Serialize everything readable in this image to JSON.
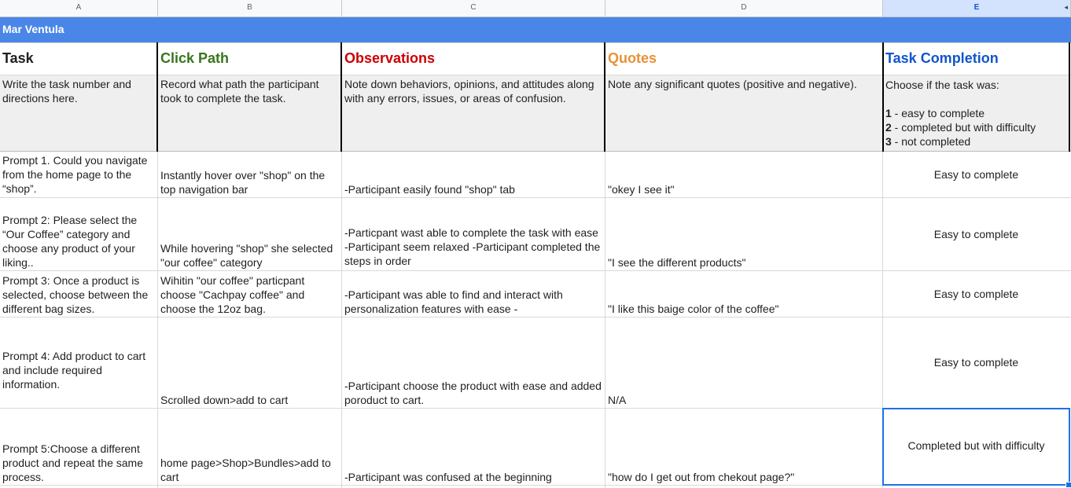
{
  "columns": [
    "A",
    "B",
    "C",
    "D",
    "E"
  ],
  "selected_column": "E",
  "title_band": "Mar Ventula",
  "headers": {
    "task": "Task",
    "click_path": "Click Path",
    "observations": "Observations",
    "quotes": "Quotes",
    "task_completion": "Task Completion"
  },
  "header_colors": {
    "task": "#000000",
    "click_path": "#38761d",
    "observations": "#cc0000",
    "quotes": "#e69138",
    "task_completion": "#1155cc"
  },
  "descriptions": {
    "task": "Write the task number and directions here.",
    "click_path": "Record what path the participant took to complete the task.",
    "observations": "Note down behaviors, opinions, and attitudes along with any errors, issues, or areas of confusion.",
    "quotes": "Note any significant quotes (positive and negative).",
    "task_completion_intro": "Choose if the task was:",
    "scale": [
      {
        "num": "1",
        "text": " - easy to complete"
      },
      {
        "num": "2",
        "text": " - completed but with difficulty"
      },
      {
        "num": "3",
        "text": " - not completed"
      }
    ]
  },
  "rows": [
    {
      "task": "Prompt 1.  Could you navigate from the home page to the “shop”.",
      "click_path": "Instantly hover over \"shop\" on the top navigation bar",
      "observations": "-Participant easily found \"shop\" tab",
      "quotes": "\"okey I see it\"",
      "completion": "Easy to complete"
    },
    {
      "task": "Prompt 2: Please select the “Our Coffee” category and choose any product of your liking..",
      "click_path": "While hovering \"shop\" she selected \"our coffee\" category",
      "observations": "-Particpant wast able to complete the task with ease -Participant seem relaxed -Participant completed the steps in order",
      "quotes": "\"I see the different products\"",
      "completion": "Easy to complete"
    },
    {
      "task": "Prompt 3: Once a product is selected, choose between the different bag sizes.",
      "click_path": "Wihitin \"our coffee\" particpant choose \"Cachpay coffee\" and choose the 12oz bag.",
      "observations": "-Participant was able to find and interact with personalization features with ease -",
      "quotes": "\"I like this baige color of the coffee\"",
      "completion": "Easy to complete"
    },
    {
      "task": "Prompt 4:  Add product to cart and include required information.",
      "click_path": "Scrolled down>add to cart",
      "observations": "-Participant choose the product with ease and added poroduct to cart.",
      "quotes": "N/A",
      "completion": "Easy to complete"
    },
    {
      "task": "Prompt 5:Choose a different product and repeat the same process.",
      "click_path": "home page>Shop>Bundles>add to cart",
      "observations": "-Participant was confused at the beginning",
      "quotes": "\"how do I get out from chekout page?\"",
      "completion": "Completed but with difficulty"
    }
  ]
}
